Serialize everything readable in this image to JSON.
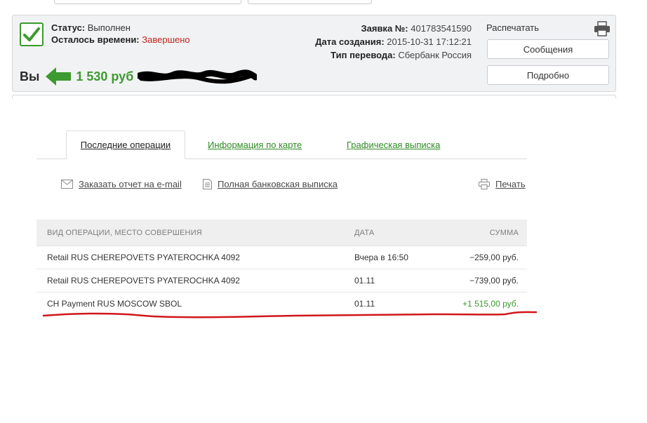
{
  "order": {
    "status_label": "Статус:",
    "status_value": "Выполнен",
    "time_left_label": "Осталось времени:",
    "time_left_value": "Завершено",
    "you_label": "Вы",
    "amount": "1 530 руб",
    "number_label": "Заявка №:",
    "number_value": "401783541590",
    "created_label": "Дата создания:",
    "created_value": "2015-10-31 17:12:21",
    "transfer_type_label": "Тип перевода:",
    "transfer_type_value": "Сбербанк Россия",
    "print_label": "Распечатать",
    "messages_button": "Сообщения",
    "details_button": "Подробно"
  },
  "tabs": [
    {
      "label": "Последние операции"
    },
    {
      "label": "Информация по карте"
    },
    {
      "label": "Графическая выписка"
    }
  ],
  "actions": {
    "email_report": "Заказать отчет на e-mail",
    "full_statement": "Полная банковская выписка",
    "print": "Печать"
  },
  "table": {
    "headers": {
      "operation": "ВИД ОПЕРАЦИИ, МЕСТО СОВЕРШЕНИЯ",
      "date": "ДАТА",
      "sum": "СУММА"
    },
    "rows": [
      {
        "operation": "Retail RUS CHEREPOVETS PYATEROCHKA 4092",
        "date": "Вчера в 16:50",
        "sum": "−259,00 руб."
      },
      {
        "operation": "Retail RUS CHEREPOVETS PYATEROCHKA 4092",
        "date": "01.11",
        "sum": "−739,00 руб."
      },
      {
        "operation": "CH Payment RUS MOSCOW SBOL",
        "date": "01.11",
        "sum": "+1 515,00 руб."
      }
    ]
  },
  "colors": {
    "accent_green": "#3c9a2f",
    "status_red": "#c2261c",
    "annotation_red": "#d0161b"
  },
  "icons": [
    "checkmark-icon",
    "arrow-left-icon",
    "printer-icon",
    "envelope-icon",
    "document-icon"
  ]
}
